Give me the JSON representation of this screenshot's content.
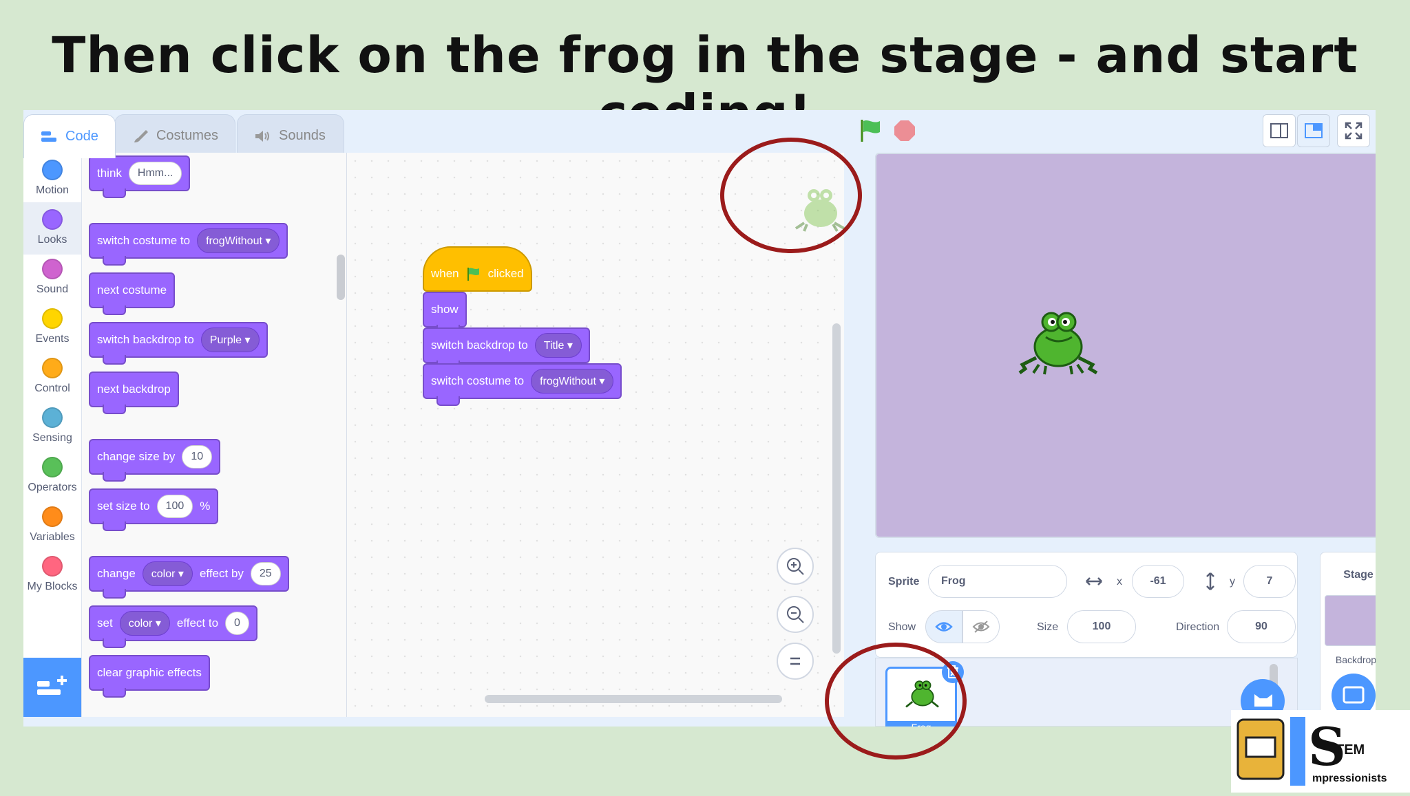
{
  "slide": {
    "title": "Then click on the frog in the stage - and start coding!"
  },
  "tabs": {
    "code": "Code",
    "costumes": "Costumes",
    "sounds": "Sounds"
  },
  "categories": [
    {
      "label": "Motion",
      "color": "#4c97ff"
    },
    {
      "label": "Looks",
      "color": "#9966ff"
    },
    {
      "label": "Sound",
      "color": "#cf63cf"
    },
    {
      "label": "Events",
      "color": "#ffd500"
    },
    {
      "label": "Control",
      "color": "#ffab19"
    },
    {
      "label": "Sensing",
      "color": "#5cb1d6"
    },
    {
      "label": "Operators",
      "color": "#59c059"
    },
    {
      "label": "Variables",
      "color": "#ff8c1a"
    },
    {
      "label": "My Blocks",
      "color": "#ff6680"
    }
  ],
  "palette": {
    "think": {
      "label": "think",
      "value": "Hmm..."
    },
    "switch_costume": {
      "label": "switch costume to",
      "value": "frogWithout"
    },
    "next_costume": "next costume",
    "switch_backdrop": {
      "label": "switch backdrop to",
      "value": "Purple"
    },
    "next_backdrop": "next backdrop",
    "change_size": {
      "label": "change size by",
      "value": "10"
    },
    "set_size": {
      "label": "set size to",
      "value": "100",
      "unit": "%"
    },
    "change_effect": {
      "label": "change",
      "effect": "color",
      "label2": "effect by",
      "value": "25"
    },
    "set_effect": {
      "label": "set",
      "effect": "color",
      "label2": "effect to",
      "value": "0"
    },
    "clear_effects": "clear graphic effects"
  },
  "script": {
    "hat": {
      "when": "when",
      "clicked": "clicked"
    },
    "show": "show",
    "switch_backdrop": {
      "label": "switch backdrop to",
      "value": "Title"
    },
    "switch_costume": {
      "label": "switch costume to",
      "value": "frogWithout"
    }
  },
  "sprite_info": {
    "sprite_label": "Sprite",
    "sprite_name": "Frog",
    "x_label": "x",
    "x_value": "-61",
    "y_label": "y",
    "y_value": "7",
    "show_label": "Show",
    "size_label": "Size",
    "size_value": "100",
    "direction_label": "Direction",
    "direction_value": "90"
  },
  "sprite_list": {
    "thumb_label": "Frog"
  },
  "stage_pane": {
    "title": "Stage",
    "backdrops": "Backdrops"
  },
  "colors": {
    "looks": "#9966ff",
    "events": "#ffbf00",
    "accent": "#4c97ff",
    "annotation": "#9b1b1b",
    "stage_bg": "#c4b4dc"
  }
}
